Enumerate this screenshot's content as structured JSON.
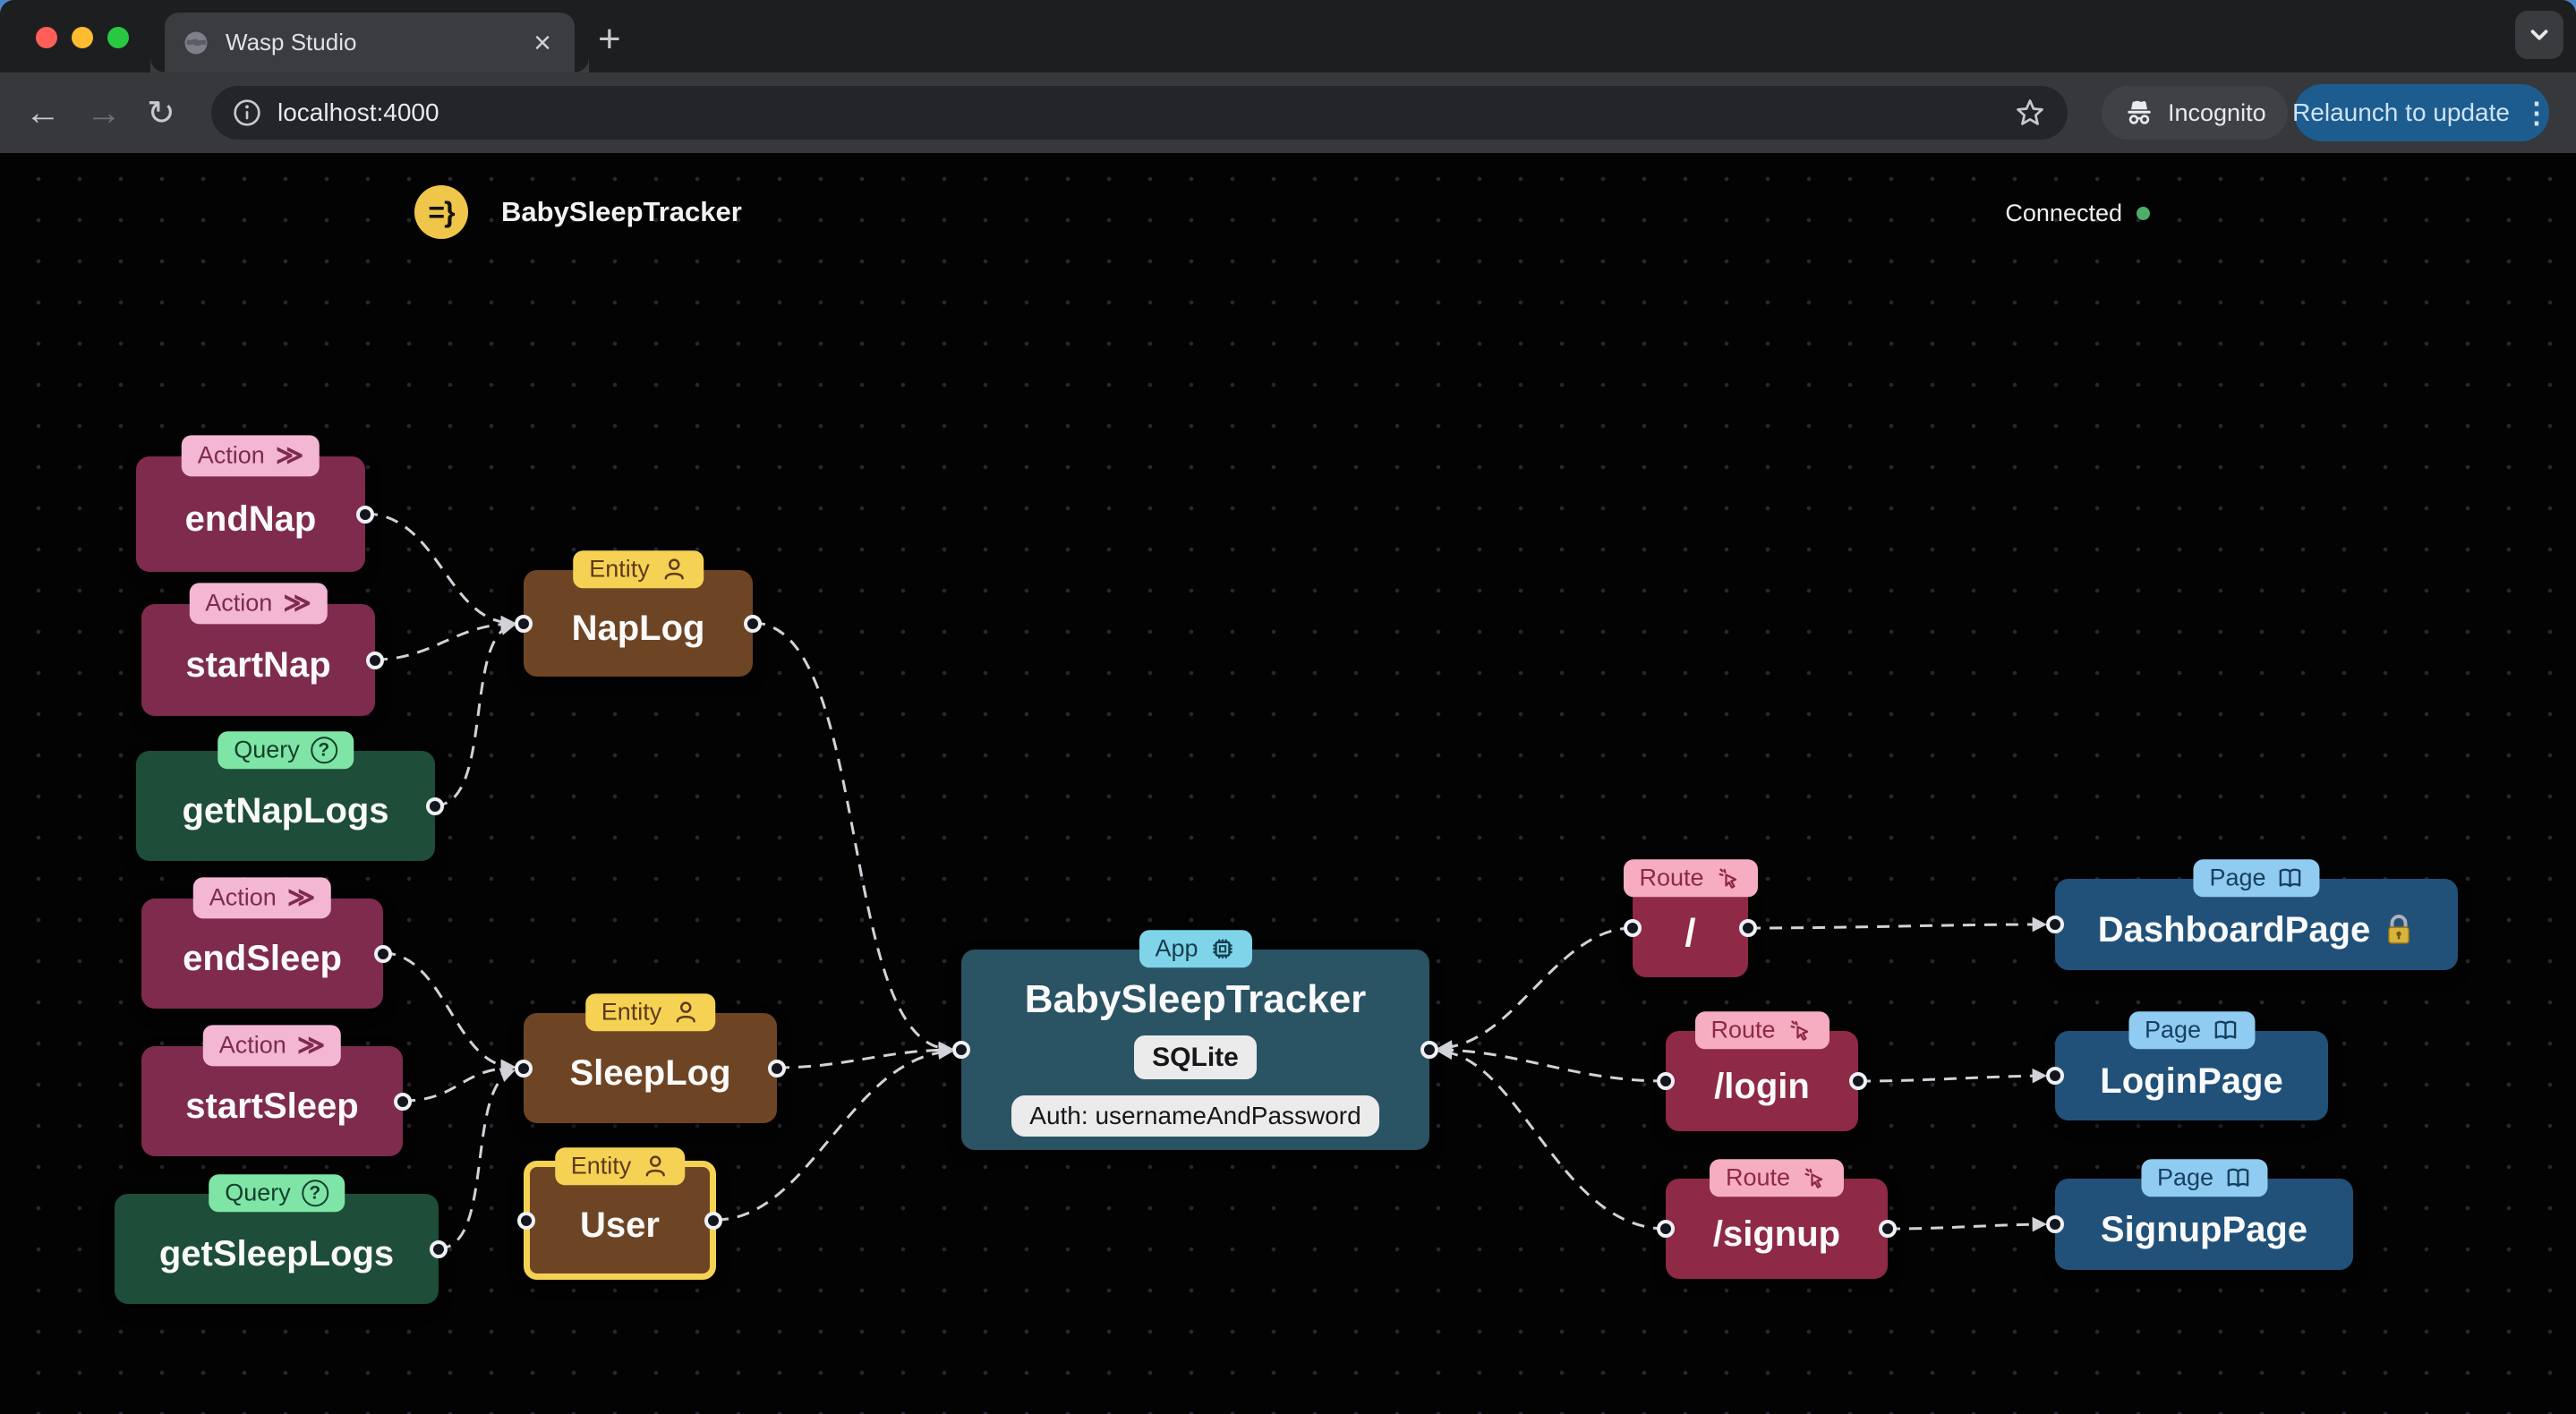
{
  "browser": {
    "tab_title": "Wasp Studio",
    "tab_close": "×",
    "new_tab_button": "+",
    "back_icon": "←",
    "forward_icon": "→",
    "reload_icon": "↻",
    "url": "localhost:4000",
    "incognito_label": "Incognito",
    "relaunch_button": "Relaunch to update",
    "menu_dots": "⋮"
  },
  "header": {
    "logo_text": "=}",
    "app_title": "BabySleepTracker",
    "connection_status": "Connected"
  },
  "canvas": {
    "nodes": [
      {
        "kind": "action",
        "badge": "Action",
        "icon": "chevrons-right",
        "label": "endNap"
      },
      {
        "kind": "action",
        "badge": "Action",
        "icon": "chevrons-right",
        "label": "startNap"
      },
      {
        "kind": "query",
        "badge": "Query",
        "icon": "question-circle",
        "label": "getNapLogs"
      },
      {
        "kind": "action",
        "badge": "Action",
        "icon": "chevrons-right",
        "label": "endSleep"
      },
      {
        "kind": "action",
        "badge": "Action",
        "icon": "chevrons-right",
        "label": "startSleep"
      },
      {
        "kind": "query",
        "badge": "Query",
        "icon": "question-circle",
        "label": "getSleepLogs"
      },
      {
        "kind": "entity",
        "badge": "Entity",
        "icon": "person",
        "label": "NapLog"
      },
      {
        "kind": "entity",
        "badge": "Entity",
        "icon": "person",
        "label": "SleepLog"
      },
      {
        "kind": "entity",
        "badge": "Entity",
        "icon": "person",
        "label": "User",
        "selected": true
      },
      {
        "kind": "app",
        "badge": "App",
        "icon": "chip",
        "label": "BabySleepTracker",
        "db": "SQLite",
        "auth": "Auth: usernameAndPassword"
      },
      {
        "kind": "route",
        "badge": "Route",
        "icon": "cursor-click",
        "label": "/"
      },
      {
        "kind": "route",
        "badge": "Route",
        "icon": "cursor-click",
        "label": "/login"
      },
      {
        "kind": "route",
        "badge": "Route",
        "icon": "cursor-click",
        "label": "/signup"
      },
      {
        "kind": "page",
        "badge": "Page",
        "icon": "book-open",
        "label": "DashboardPage",
        "locked": true
      },
      {
        "kind": "page",
        "badge": "Page",
        "icon": "book-open",
        "label": "LoginPage"
      },
      {
        "kind": "page",
        "badge": "Page",
        "icon": "book-open",
        "label": "SignupPage"
      }
    ],
    "badge_action_icon": "≫"
  },
  "colors": {
    "action_node": "#7e2b4e",
    "action_badge": "#f3b7d3",
    "query_node": "#1e4d39",
    "query_badge": "#7fe5a6",
    "entity_node": "#6e4524",
    "entity_badge": "#f6d254",
    "app_node": "#2a5363",
    "app_badge": "#7fd4e9",
    "route_node": "#8e2946",
    "route_badge": "#f6adc1",
    "page_node": "#215179",
    "page_badge": "#90cbf1",
    "edge": "#d2d3d8",
    "connected_dot": "#4cae68",
    "relaunch_button": "#1d5c8e",
    "wasp_logo": "#efc64a"
  }
}
